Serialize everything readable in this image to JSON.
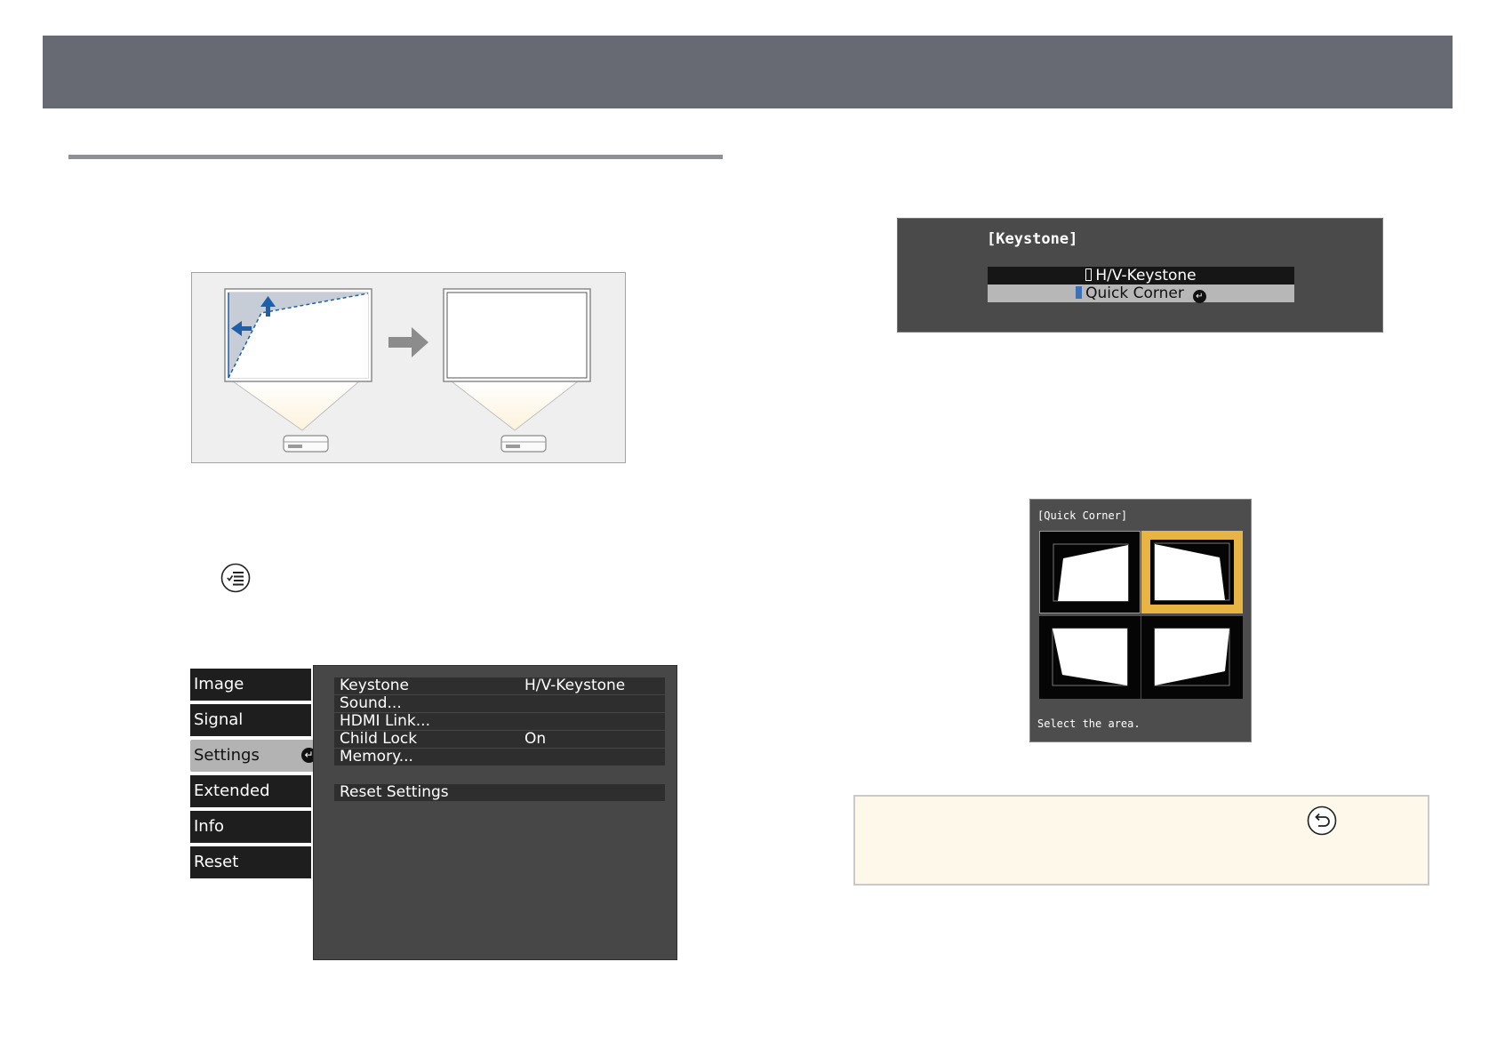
{
  "settings_menu": {
    "tabs": [
      {
        "label": "Image"
      },
      {
        "label": "Signal"
      },
      {
        "label": "Settings"
      },
      {
        "label": "Extended"
      },
      {
        "label": "Info"
      },
      {
        "label": "Reset"
      }
    ],
    "active_tab": "Settings",
    "rows": [
      {
        "label": "Keystone",
        "value": "H/V-Keystone"
      },
      {
        "label": "Sound...",
        "value": ""
      },
      {
        "label": "HDMI Link...",
        "value": ""
      },
      {
        "label": "Child Lock",
        "value": "On"
      },
      {
        "label": "Memory...",
        "value": ""
      }
    ],
    "reset_label": "Reset Settings"
  },
  "keystone_dialog": {
    "title": "[Keystone]",
    "options": [
      {
        "label": "H/V-Keystone"
      },
      {
        "label": "Quick Corner"
      }
    ],
    "selected": "Quick Corner"
  },
  "quick_corner_dialog": {
    "title": "[Quick Corner]",
    "hint": "Select the area.",
    "selected_cell": "top-right"
  },
  "colors": {
    "banner": "#676a73",
    "selection_highlight": "#e8b545",
    "arrow_blue": "#1f5fa8",
    "note_background": "#fdf8ea"
  },
  "icons": [
    "menu-button-icon",
    "back-button-icon",
    "enter-icon"
  ]
}
